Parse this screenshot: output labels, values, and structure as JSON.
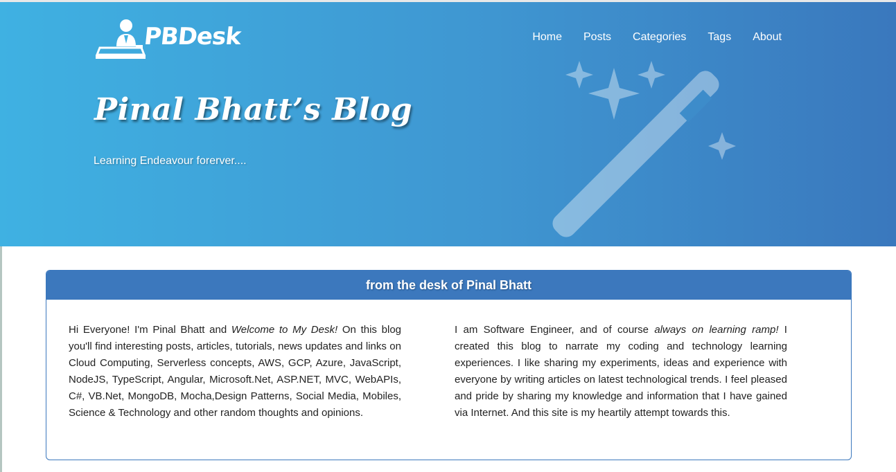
{
  "header": {
    "logo_text": "PBDesk",
    "nav": [
      {
        "label": "Home"
      },
      {
        "label": "Posts"
      },
      {
        "label": "Categories"
      },
      {
        "label": "Tags"
      },
      {
        "label": "About"
      }
    ],
    "title": "Pinal Bhatt’s Blog",
    "tagline": "Learning Endeavour forerver...."
  },
  "card": {
    "title": "from the desk of Pinal Bhatt",
    "left": {
      "part1": "Hi Everyone! I'm Pinal Bhatt and ",
      "emphasis": "Welcome to My Desk!",
      "part2": " On this blog you'll find interesting posts, articles, tutorials, news updates and links on Cloud Computing, Serverless concepts, AWS, GCP, Azure, JavaScript, NodeJS, TypeScript, Angular, Microsoft.Net, ASP.NET, MVC, WebAPIs, C#, VB.Net, MongoDB, Mocha,Design Patterns, Social Media, Mobiles, Science & Technology and other random thoughts and opinions."
    },
    "right": {
      "part1": "I am Software Engineer, and of course ",
      "emphasis": "always on learning ramp!",
      "part2": " I created this blog to narrate my coding and technology learning experiences. I like sharing my experiments, ideas and experience with everyone by writing articles on latest technological trends. I feel pleased and pride by sharing my knowledge and information that I have gained via Internet. And this site is my heartily attempt towards this."
    }
  },
  "colors": {
    "hero_start": "#3fb1e2",
    "hero_end": "#3a78bd",
    "card_header": "#3c78bd",
    "text": "#222222"
  }
}
